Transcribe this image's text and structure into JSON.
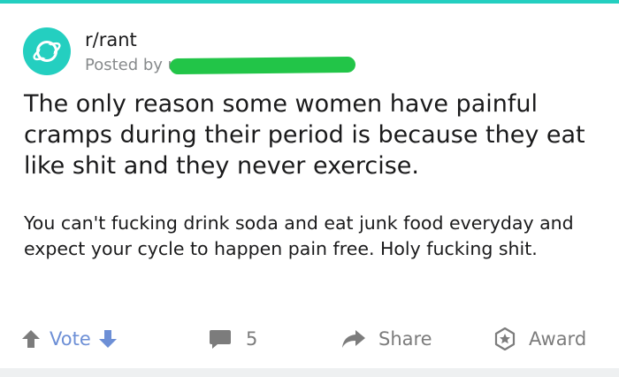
{
  "post": {
    "subreddit": "r/rant",
    "posted_by_prefix": "Posted by u/",
    "title": "The only reason some women have painful cramps during their period is because they eat like shit and they never exercise.",
    "body": "You can't fucking drink soda and eat junk food everyday and expect your cycle to happen pain free. Holy fucking shit."
  },
  "actions": {
    "vote_label": "Vote",
    "comment_count": "5",
    "share_label": "Share",
    "award_label": "Award"
  },
  "icons": {
    "community": "planet-icon",
    "upvote": "arrow-up-icon",
    "downvote": "arrow-down-icon",
    "comments": "comment-icon",
    "share": "share-arrow-icon",
    "award": "award-star-icon"
  },
  "colors": {
    "accent": "#24cfc0",
    "vote_blue": "#6d8fd6",
    "redaction_green": "#22c548",
    "action_gray": "#7c7c7c"
  }
}
